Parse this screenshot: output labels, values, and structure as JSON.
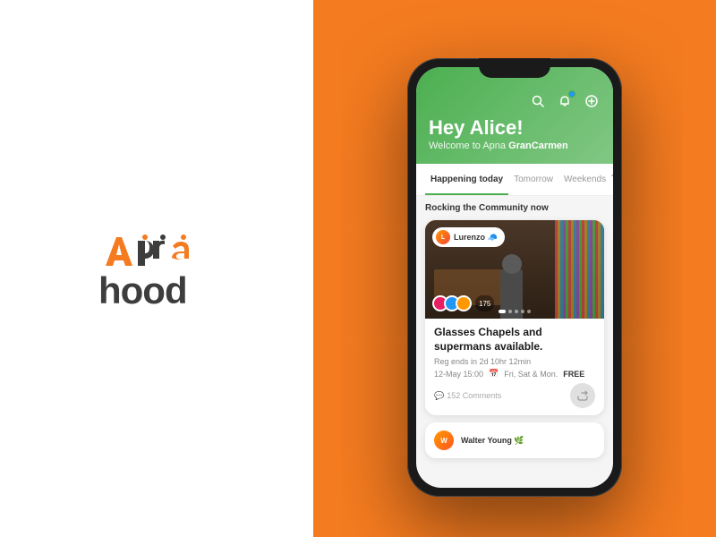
{
  "brand": {
    "name": "Apna hood",
    "apna": "Apna",
    "hood": "hood"
  },
  "colors": {
    "green": "#4CAF50",
    "orange": "#F47B20",
    "dark": "#3d3d3d"
  },
  "app": {
    "header": {
      "greeting": "Hey Alice!",
      "welcome_text": "Welcome to Apna ",
      "location": "GranCarmen",
      "icons": {
        "search": "🔍",
        "notification": "🔔",
        "add": "➕"
      }
    },
    "tabs": [
      {
        "label": "Happening today",
        "active": true
      },
      {
        "label": "Tomorrow",
        "active": false
      },
      {
        "label": "Weekends",
        "active": false
      }
    ],
    "section_title": "Rocking the Community now",
    "event_card": {
      "user": "Lurenzo",
      "user_emoji": "🧢",
      "title": "Glasses Chapels and supermans available.",
      "reg_ends": "Reg ends in  2d 10hr 12min",
      "date": "12-May 15:00",
      "days": "Fri, Sat & Mon.",
      "price": "FREE",
      "comments": "152 Comments",
      "attendee_count": "175"
    },
    "preview_card": {
      "user": "Walter Young",
      "user_emoji": "🌿"
    }
  }
}
